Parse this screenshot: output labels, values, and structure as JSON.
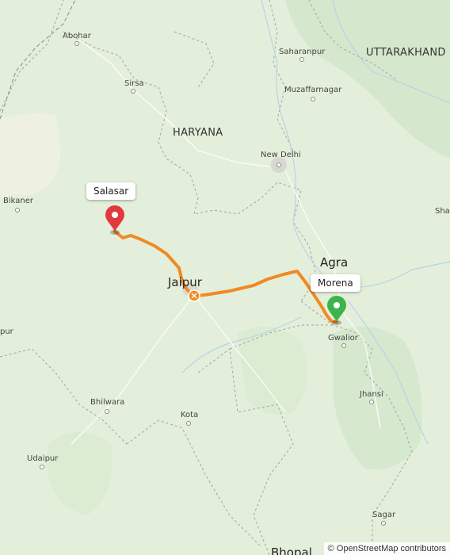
{
  "places": {
    "abohar": "Abohar",
    "saharanpur": "Saharanpur",
    "sirsa": "Sirsa",
    "muzaffarnagar": "Muzaffarnagar",
    "new_delhi": "New Delhi",
    "bikaner": "Bikaner",
    "jaipur": "Jaipur",
    "agra": "Agra",
    "gwalior": "Gwalior",
    "jhansi": "Jhansi",
    "bhilwara": "Bhilwara",
    "kota": "Kota",
    "udaipur": "Udaipur",
    "sagar": "Sagar",
    "bhopal": "Bhopal",
    "jodhpur_partial": "pur",
    "shahjahanpur_partial": "Sha"
  },
  "regions": {
    "haryana": "HARYANA",
    "uttarakhand": "UTTARAKHAND"
  },
  "route": {
    "start": {
      "label": "Morena",
      "color": "#3cb44b"
    },
    "end": {
      "label": "Salasar",
      "color": "#e03a3e"
    },
    "line_color": "#f08a24"
  },
  "attribution": {
    "symbol": "©",
    "text": "OpenStreetMap contributors"
  }
}
